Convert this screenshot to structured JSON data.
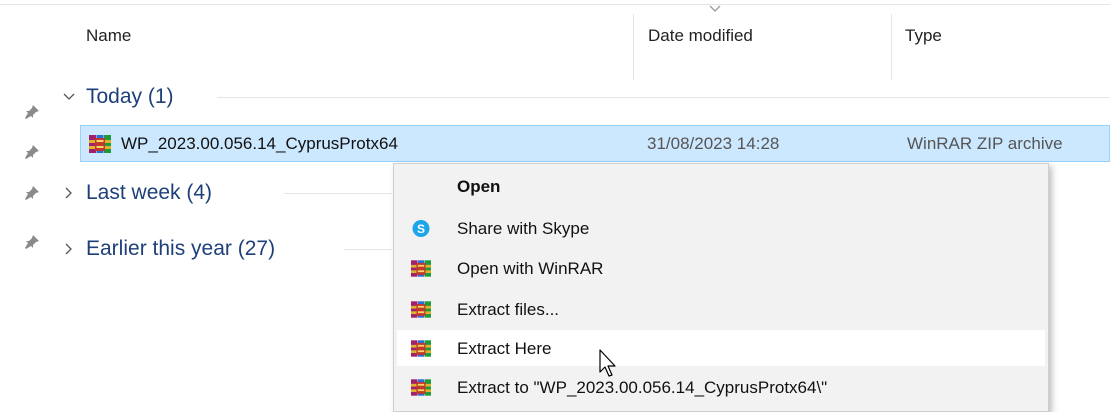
{
  "columns": {
    "name": "Name",
    "date_modified": "Date modified",
    "type": "Type"
  },
  "groups": [
    {
      "label": "Today (1)",
      "expanded": true
    },
    {
      "label": "Last week (4)",
      "expanded": false
    },
    {
      "label": "Earlier this year (27)",
      "expanded": false
    }
  ],
  "file": {
    "name": "WP_2023.00.056.14_CyprusProtx64",
    "date": "31/08/2023 14:28",
    "type": "WinRAR ZIP archive",
    "selected": true
  },
  "context_menu": {
    "items": [
      {
        "label": "Open",
        "icon": "none",
        "bold": true
      },
      {
        "label": "Share with Skype",
        "icon": "skype-icon"
      },
      {
        "label": "Open with WinRAR",
        "icon": "winrar-icon"
      },
      {
        "label": "Extract files...",
        "icon": "winrar-icon"
      },
      {
        "label": "Extract Here",
        "icon": "winrar-icon",
        "hovered": true
      },
      {
        "label": "Extract to \"WP_2023.00.056.14_CyprusProtx64\\\"",
        "icon": "winrar-icon"
      }
    ]
  },
  "colors": {
    "group_text": "#1e3f7a",
    "selection_bg": "#cce8ff",
    "selection_border": "#99d1ff",
    "menu_bg": "#f2f2f2",
    "skype_blue": "#1ea5e9"
  }
}
